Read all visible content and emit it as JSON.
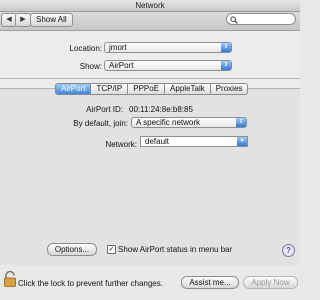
{
  "window": {
    "title": "Network"
  },
  "toolbar": {
    "back": "◀",
    "forward": "▶",
    "show_all": "Show All",
    "search_placeholder": ""
  },
  "form": {
    "location_label": "Location:",
    "location_value": "jmort",
    "show_label": "Show:",
    "show_value": "AirPort"
  },
  "tabs": [
    {
      "label": "AirPort",
      "active": true
    },
    {
      "label": "TCP/IP",
      "active": false
    },
    {
      "label": "PPPoE",
      "active": false
    },
    {
      "label": "AppleTalk",
      "active": false
    },
    {
      "label": "Proxies",
      "active": false
    }
  ],
  "airport": {
    "id_label": "AirPort ID:",
    "id_value": "00:11:24:8e:b8:85",
    "join_label": "By default, join:",
    "join_value": "A specific network",
    "network_label": "Network:",
    "network_value": "default"
  },
  "options": {
    "options_button": "Options...",
    "show_status_label": "Show AirPort status in menu bar",
    "show_status_checked": true
  },
  "help": {
    "label": "?"
  },
  "footer": {
    "lock_text": "Click the lock to prevent further changes.",
    "assist_button": "Assist me...",
    "apply_button": "Apply Now"
  }
}
